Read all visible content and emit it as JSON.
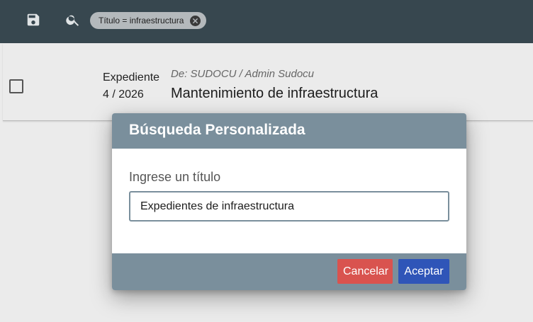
{
  "toolbar": {
    "save_icon": "save-icon",
    "search_icon": "search-icon",
    "filter_chip": {
      "label": "Título = infraestructura",
      "close_icon": "close-icon"
    }
  },
  "list": {
    "items": [
      {
        "type": "Expediente",
        "number": "4 / 2026",
        "from": "De: SUDOCU / Admin Sudocu",
        "subject": "Mantenimiento de infraestructura",
        "checked": false
      }
    ]
  },
  "dialog": {
    "title": "Búsqueda Personalizada",
    "field_label": "Ingrese un título",
    "field_value": "Expedientes de infraestructura",
    "cancel_label": "Cancelar",
    "ok_label": "Aceptar"
  },
  "colors": {
    "toolbar_bg": "#37474f",
    "dialog_header_bg": "#7a8f9c",
    "cancel_bg": "#d9534f",
    "ok_bg": "#2f55b8"
  }
}
